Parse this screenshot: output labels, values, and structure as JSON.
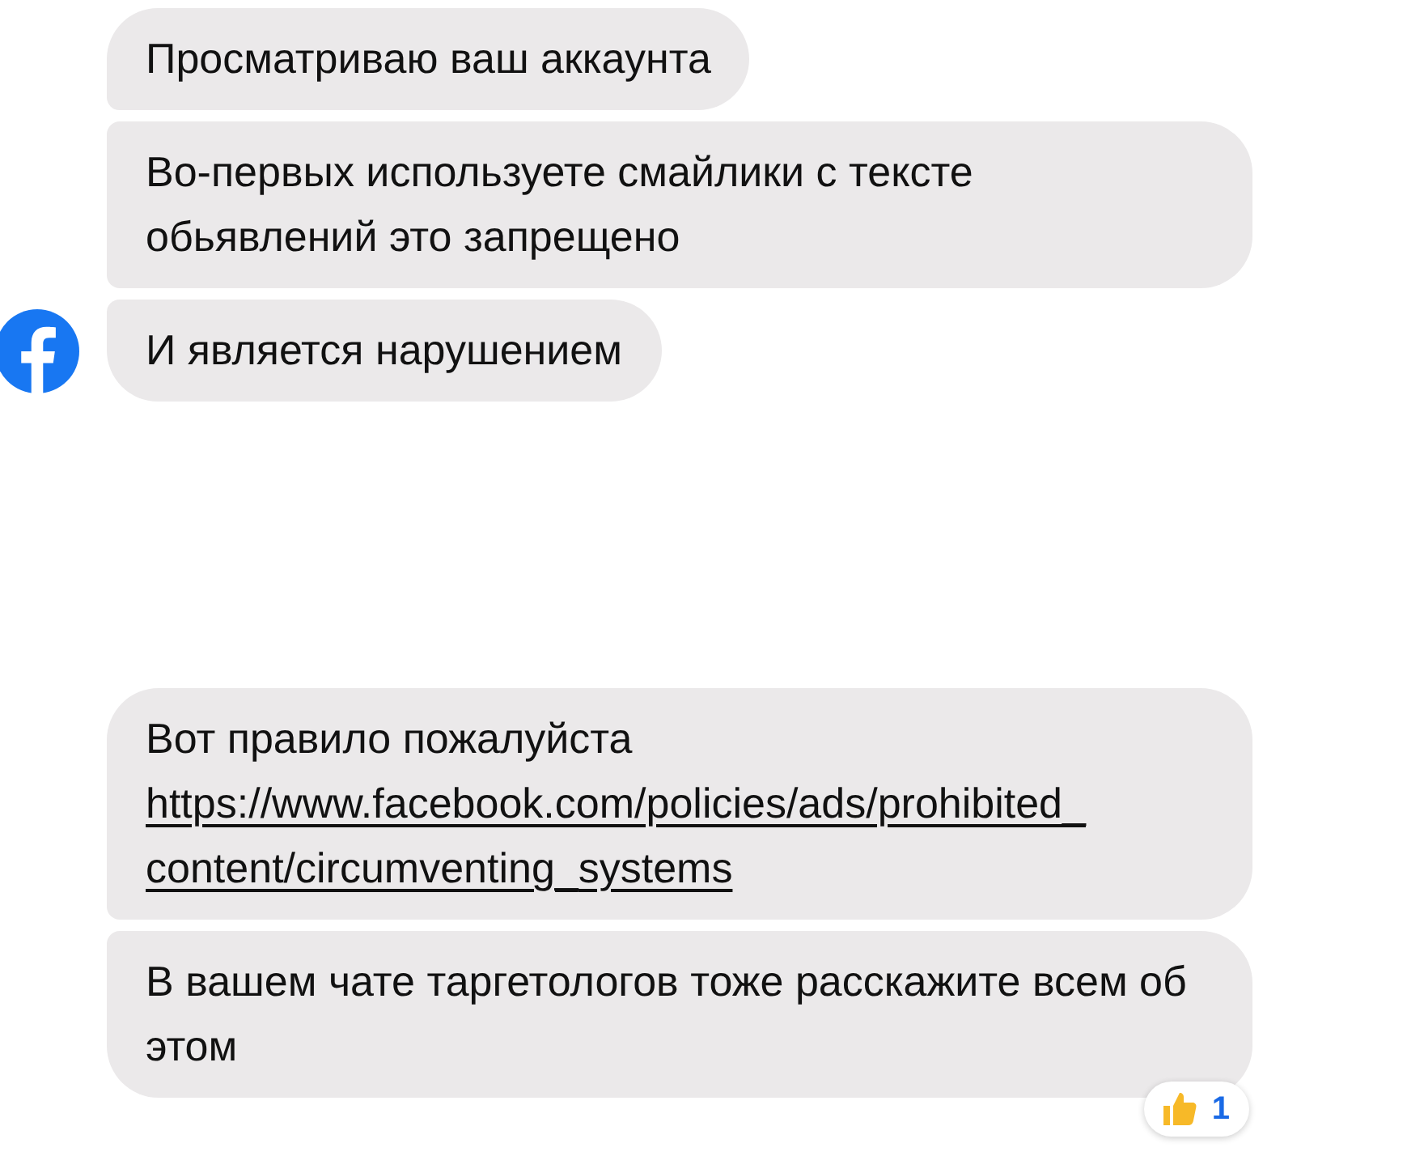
{
  "groups": [
    {
      "avatar": true,
      "messages": [
        {
          "text": "Просматриваю ваш аккаунта"
        },
        {
          "text": "Во-первых используете смайлики с тексте обьявлений это запрещено"
        },
        {
          "text": "И является нарушением"
        }
      ]
    },
    {
      "avatar": false,
      "messages": [
        {
          "text": "Вот правило пожалуйста",
          "link": "https://www.facebook.com/policies/ads/prohibited_content/circumventing_systems"
        },
        {
          "text": "В вашем чате таргетологов тоже расскажите всем об этом",
          "reaction": {
            "kind": "like",
            "count": "1"
          }
        }
      ]
    }
  ]
}
